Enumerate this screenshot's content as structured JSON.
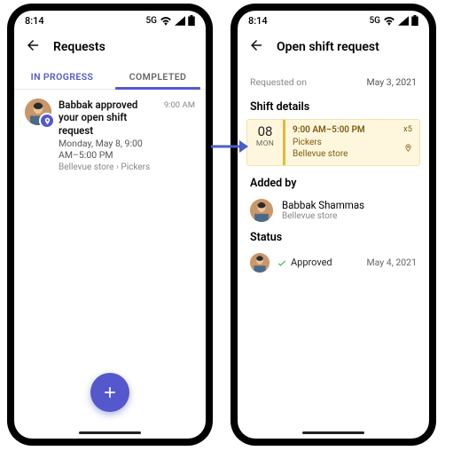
{
  "statusbar": {
    "time": "8:14",
    "network": "5G"
  },
  "phone1": {
    "title": "Requests",
    "tabs": {
      "in_progress": "IN PROGRESS",
      "completed": "COMPLETED"
    },
    "item": {
      "title": "Babbak approved your open shift request",
      "subtitle": "Monday, May 8, 9:00 AM–5:00 PM",
      "meta_store": "Bellevue store",
      "meta_role": "Pickers",
      "time": "9:00 AM"
    }
  },
  "phone2": {
    "title": "Open shift request",
    "requested_on_label": "Requested on",
    "requested_on_value": "May 3, 2021",
    "shift_heading": "Shift details",
    "shift": {
      "day_num": "08",
      "day_dow": "MON",
      "time": "9:00 AM–5:00 PM",
      "role": "Pickers",
      "store": "Bellevue store",
      "count": "x5"
    },
    "added_heading": "Added by",
    "added_name": "Babbak Shammas",
    "added_store": "Bellevue store",
    "status_heading": "Status",
    "status_value": "Approved",
    "status_date": "May 4, 2021"
  }
}
